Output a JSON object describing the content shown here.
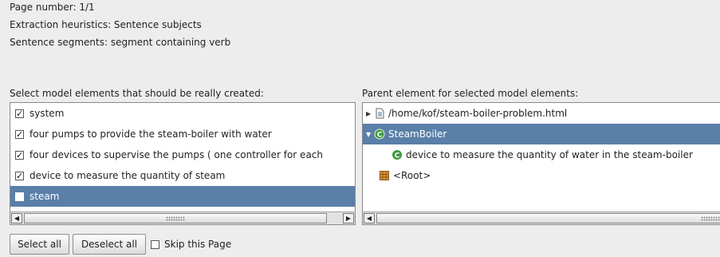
{
  "header": {
    "page_number": "Page number: 1/1",
    "heuristics": "Extraction heuristics: Sentence subjects",
    "segments": "Sentence segments: segment containing verb"
  },
  "left": {
    "label": "Select model elements that should be really created:",
    "items": [
      {
        "label": "system",
        "checked": true
      },
      {
        "label": "four pumps to provide the steam-boiler with water",
        "checked": true
      },
      {
        "label": "four devices to supervise the pumps ( one controller for each",
        "checked": true
      },
      {
        "label": "device to measure the quantity of steam",
        "checked": true
      },
      {
        "label": "steam",
        "checked": false,
        "selected": true
      }
    ]
  },
  "right": {
    "label": "Parent element for selected model elements:",
    "tree": [
      {
        "label": "/home/kof/steam-boiler-problem.html",
        "icon": "file-icon",
        "expander": "collapsed"
      },
      {
        "label": "SteamBoiler",
        "icon": "class-icon",
        "expander": "expanded",
        "selected": true
      },
      {
        "label": "device to measure the quantity of water in the steam-boiler",
        "icon": "class-icon"
      },
      {
        "label": "<Root>",
        "icon": "package-icon"
      }
    ]
  },
  "buttons": {
    "select_all": "Select all",
    "deselect_all": "Deselect all",
    "skip_page": "Skip this Page"
  },
  "colors": {
    "selection": "#5a7fa8",
    "background": "#ededed",
    "class_icon": "#3f9a3f"
  }
}
